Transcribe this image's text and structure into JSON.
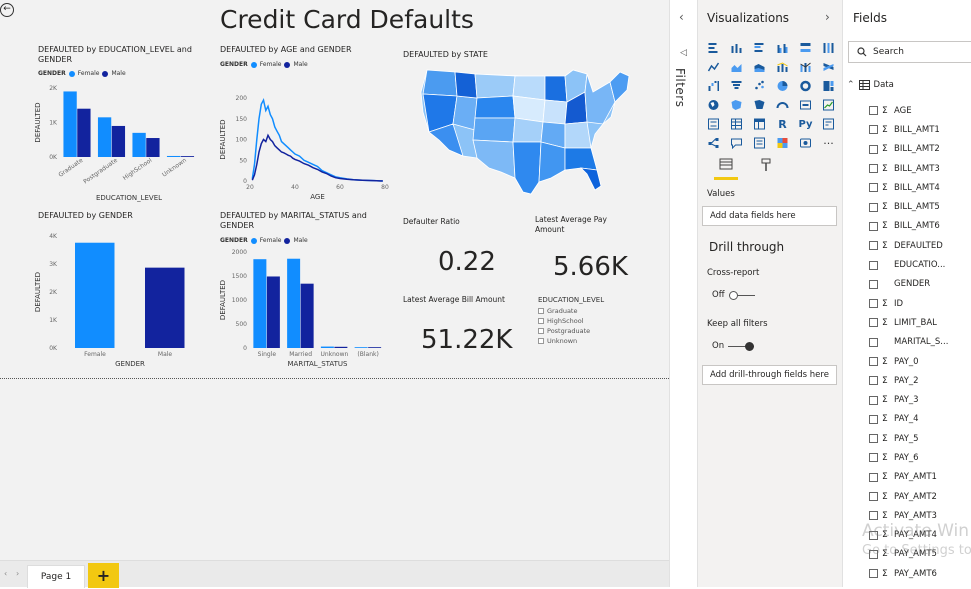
{
  "report": {
    "title": "Credit Card Defaults",
    "back_icon": "back-arrow-icon"
  },
  "visuals": {
    "edu_chart": {
      "title": "DEFAULTED by EDUCATION_LEVEL and GENDER",
      "legend_title": "GENDER",
      "legend": [
        "Female",
        "Male"
      ]
    },
    "age_chart": {
      "title": "DEFAULTED by AGE and GENDER",
      "legend_title": "GENDER",
      "legend": [
        "Female",
        "Male"
      ]
    },
    "state_map": {
      "title": "DEFAULTED by STATE"
    },
    "gender_chart": {
      "title": "DEFAULTED by GENDER"
    },
    "marital_chart": {
      "title": "DEFAULTED by MARITAL_STATUS and GENDER",
      "legend_title": "GENDER",
      "legend": [
        "Female",
        "Male"
      ]
    },
    "cards": {
      "defaulter_ratio": {
        "title": "Defaulter Ratio",
        "value": "0.22"
      },
      "latest_avg_pay": {
        "title": "Latest Average Pay Amount",
        "value": "5.66K"
      },
      "latest_avg_bill": {
        "title": "Latest Average Bill Amount",
        "value": "51.22K"
      }
    },
    "slicer": {
      "title": "EDUCATION_LEVEL",
      "items": [
        "Graduate",
        "HighSchool",
        "Postgraduate",
        "Unknown"
      ]
    }
  },
  "colors": {
    "female": "#118dff",
    "male": "#12239e",
    "accent": "#f2c811"
  },
  "chart_data": [
    {
      "type": "bar",
      "title": "DEFAULTED by EDUCATION_LEVEL and GENDER",
      "xlabel": "EDUCATION_LEVEL",
      "ylabel": "DEFAULTED",
      "categories": [
        "Graduate",
        "Postgraduate",
        "HighSchool",
        "Unknown"
      ],
      "ylim": [
        0,
        2000
      ],
      "yticks": [
        "0K",
        "1K",
        "2K"
      ],
      "series": [
        {
          "name": "Female",
          "values": [
            1900,
            1150,
            700,
            30
          ]
        },
        {
          "name": "Male",
          "values": [
            1400,
            900,
            550,
            25
          ]
        }
      ]
    },
    {
      "type": "line",
      "title": "DEFAULTED by AGE and GENDER",
      "xlabel": "AGE",
      "ylabel": "DEFAULTED",
      "xlim": [
        20,
        80
      ],
      "ylim": [
        0,
        200
      ],
      "xticks": [
        "20",
        "40",
        "60",
        "80"
      ],
      "yticks": [
        "0",
        "50",
        "100",
        "150",
        "200"
      ],
      "series": [
        {
          "name": "Female",
          "x": [
            21,
            22,
            23,
            24,
            25,
            26,
            27,
            28,
            29,
            30,
            31,
            32,
            33,
            34,
            35,
            36,
            37,
            38,
            39,
            40,
            42,
            44,
            46,
            48,
            50,
            52,
            54,
            56,
            58,
            60,
            63,
            66,
            70,
            75,
            79
          ],
          "values": [
            5,
            40,
            100,
            150,
            185,
            195,
            170,
            180,
            160,
            150,
            130,
            120,
            110,
            95,
            90,
            85,
            80,
            75,
            70,
            65,
            60,
            50,
            45,
            40,
            35,
            25,
            20,
            15,
            10,
            8,
            5,
            3,
            2,
            1,
            0
          ]
        },
        {
          "name": "Male",
          "x": [
            21,
            22,
            23,
            24,
            25,
            26,
            27,
            28,
            29,
            30,
            31,
            32,
            33,
            34,
            35,
            36,
            37,
            38,
            39,
            40,
            42,
            44,
            46,
            48,
            50,
            52,
            54,
            56,
            58,
            60,
            63,
            66,
            70,
            75,
            79
          ],
          "values": [
            2,
            15,
            40,
            70,
            90,
            100,
            95,
            110,
            100,
            95,
            85,
            80,
            75,
            70,
            68,
            65,
            62,
            60,
            55,
            52,
            48,
            42,
            38,
            32,
            28,
            22,
            18,
            12,
            8,
            6,
            4,
            3,
            2,
            1,
            0
          ]
        }
      ]
    },
    {
      "type": "bar",
      "title": "DEFAULTED by GENDER",
      "xlabel": "GENDER",
      "ylabel": "DEFAULTED",
      "categories": [
        "Female",
        "Male"
      ],
      "ylim": [
        0,
        4000
      ],
      "yticks": [
        "0K",
        "1K",
        "2K",
        "3K",
        "4K"
      ],
      "series": [
        {
          "values": [
            3760,
            2870
          ]
        }
      ]
    },
    {
      "type": "bar",
      "title": "DEFAULTED by MARITAL_STATUS and GENDER",
      "xlabel": "MARITAL_STATUS",
      "ylabel": "DEFAULTED",
      "categories": [
        "Single",
        "Married",
        "Unknown",
        "(Blank)"
      ],
      "ylim": [
        0,
        2000
      ],
      "yticks": [
        "0",
        "500",
        "1000",
        "1500",
        "2000"
      ],
      "series": [
        {
          "name": "Female",
          "values": [
            1850,
            1860,
            30,
            5
          ]
        },
        {
          "name": "Male",
          "values": [
            1490,
            1340,
            25,
            3
          ]
        }
      ]
    }
  ],
  "bottom_bar": {
    "page_tab": "Page 1",
    "add_label": "+"
  },
  "filters_pane": {
    "label": "Filters"
  },
  "viz_pane": {
    "title": "Visualizations",
    "values_label": "Values",
    "values_placeholder": "Add data fields here",
    "drill_title": "Drill through",
    "cross_report_label": "Cross-report",
    "cross_report_state": "Off",
    "keep_filters_label": "Keep all filters",
    "keep_filters_state": "On",
    "drill_placeholder": "Add drill-through fields here"
  },
  "fields_pane": {
    "title": "Fields",
    "search_placeholder": "Search",
    "table_name": "Data",
    "fields": [
      {
        "name": "AGE",
        "sigma": "Σ"
      },
      {
        "name": "BILL_AMT1",
        "sigma": "Σ"
      },
      {
        "name": "BILL_AMT2",
        "sigma": "Σ"
      },
      {
        "name": "BILL_AMT3",
        "sigma": "Σ"
      },
      {
        "name": "BILL_AMT4",
        "sigma": "Σ"
      },
      {
        "name": "BILL_AMT5",
        "sigma": "Σ"
      },
      {
        "name": "BILL_AMT6",
        "sigma": "Σ"
      },
      {
        "name": "DEFAULTED",
        "sigma": "Σ"
      },
      {
        "name": "EDUCATIO...",
        "sigma": ""
      },
      {
        "name": "GENDER",
        "sigma": ""
      },
      {
        "name": "ID",
        "sigma": "Σ"
      },
      {
        "name": "LIMIT_BAL",
        "sigma": "Σ"
      },
      {
        "name": "MARITAL_S...",
        "sigma": ""
      },
      {
        "name": "PAY_0",
        "sigma": "Σ"
      },
      {
        "name": "PAY_2",
        "sigma": "Σ"
      },
      {
        "name": "PAY_3",
        "sigma": "Σ"
      },
      {
        "name": "PAY_4",
        "sigma": "Σ"
      },
      {
        "name": "PAY_5",
        "sigma": "Σ"
      },
      {
        "name": "PAY_6",
        "sigma": "Σ"
      },
      {
        "name": "PAY_AMT1",
        "sigma": "Σ"
      },
      {
        "name": "PAY_AMT2",
        "sigma": "Σ"
      },
      {
        "name": "PAY_AMT3",
        "sigma": "Σ"
      },
      {
        "name": "PAY_AMT4",
        "sigma": "Σ"
      },
      {
        "name": "PAY_AMT5",
        "sigma": "Σ"
      },
      {
        "name": "PAY_AMT6",
        "sigma": "Σ"
      }
    ]
  },
  "watermark": {
    "line1": "Activate Win",
    "line2": "Go to Settings to"
  }
}
